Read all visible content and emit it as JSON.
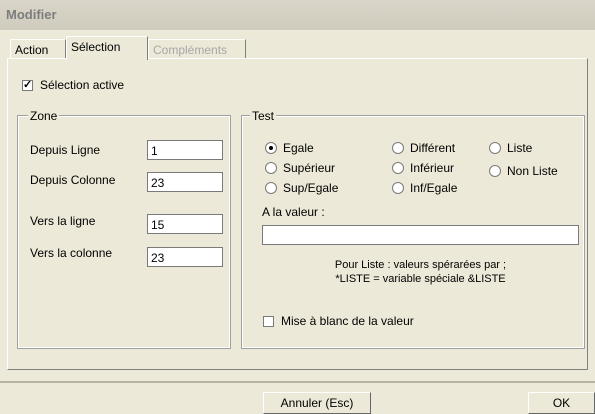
{
  "window": {
    "title": "Modifier"
  },
  "tabs": [
    {
      "label": "Action"
    },
    {
      "label": "Sélection"
    },
    {
      "label": "Compléments"
    }
  ],
  "selection_active": {
    "label": "Sélection active",
    "checked": true
  },
  "zone": {
    "legend": "Zone",
    "fields": [
      {
        "label": "Depuis Ligne",
        "value": "1"
      },
      {
        "label": "Depuis Colonne",
        "value": "23"
      },
      {
        "label": "Vers la ligne",
        "value": "15"
      },
      {
        "label": "Vers la colonne",
        "value": "23"
      }
    ]
  },
  "test": {
    "legend": "Test",
    "options": [
      {
        "label": "Egale",
        "checked": true
      },
      {
        "label": "Différent",
        "checked": false
      },
      {
        "label": "Liste",
        "checked": false
      },
      {
        "label": "Supérieur",
        "checked": false
      },
      {
        "label": "Inférieur",
        "checked": false
      },
      {
        "label": "Non Liste",
        "checked": false
      },
      {
        "label": "Sup/Egale",
        "checked": false
      },
      {
        "label": "Inf/Egale",
        "checked": false
      }
    ],
    "value_label": "A la valeur :",
    "value": "",
    "hint_line1": "Pour Liste : valeurs spérarées par ;",
    "hint_line2": "*LISTE = variable spéciale &LISTE",
    "blank_label": "Mise à blanc de la valeur",
    "blank_checked": false
  },
  "buttons": {
    "cancel": "Annuler (Esc)",
    "ok": "OK"
  }
}
